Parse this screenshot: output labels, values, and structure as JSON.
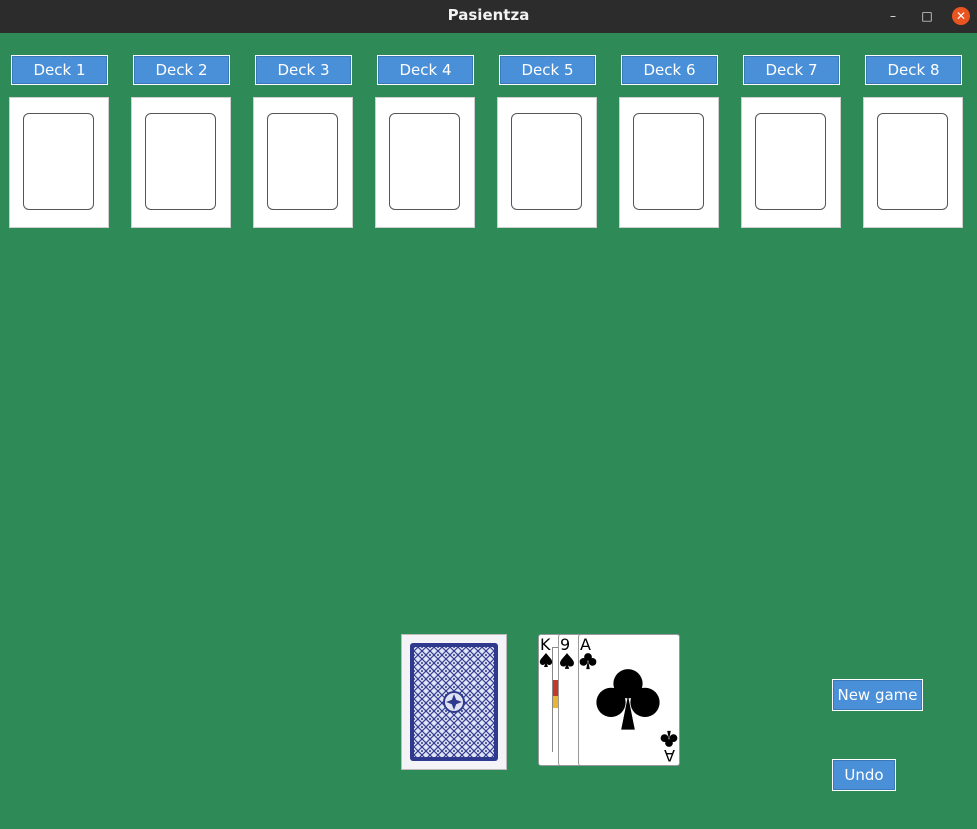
{
  "window": {
    "title": "Pasientza",
    "minimize_glyph": "–",
    "maximize_glyph": "□",
    "close_glyph": "✕"
  },
  "decks": [
    {
      "label": "Deck 1"
    },
    {
      "label": "Deck 2"
    },
    {
      "label": "Deck 3"
    },
    {
      "label": "Deck 4"
    },
    {
      "label": "Deck 5"
    },
    {
      "label": "Deck 6"
    },
    {
      "label": "Deck 7"
    },
    {
      "label": "Deck 8"
    }
  ],
  "waste": [
    {
      "rank": "K",
      "suit": "spades"
    },
    {
      "rank": "9",
      "suit": "spades"
    },
    {
      "rank": "A",
      "suit": "clubs"
    }
  ],
  "buttons": {
    "new_game": "New game",
    "undo": "Undo"
  },
  "colors": {
    "table": "#2e8b57",
    "button": "#4a90d9",
    "titlebar": "#2c2c2c",
    "close": "#e95420",
    "card_back": "#2f3a8f"
  }
}
